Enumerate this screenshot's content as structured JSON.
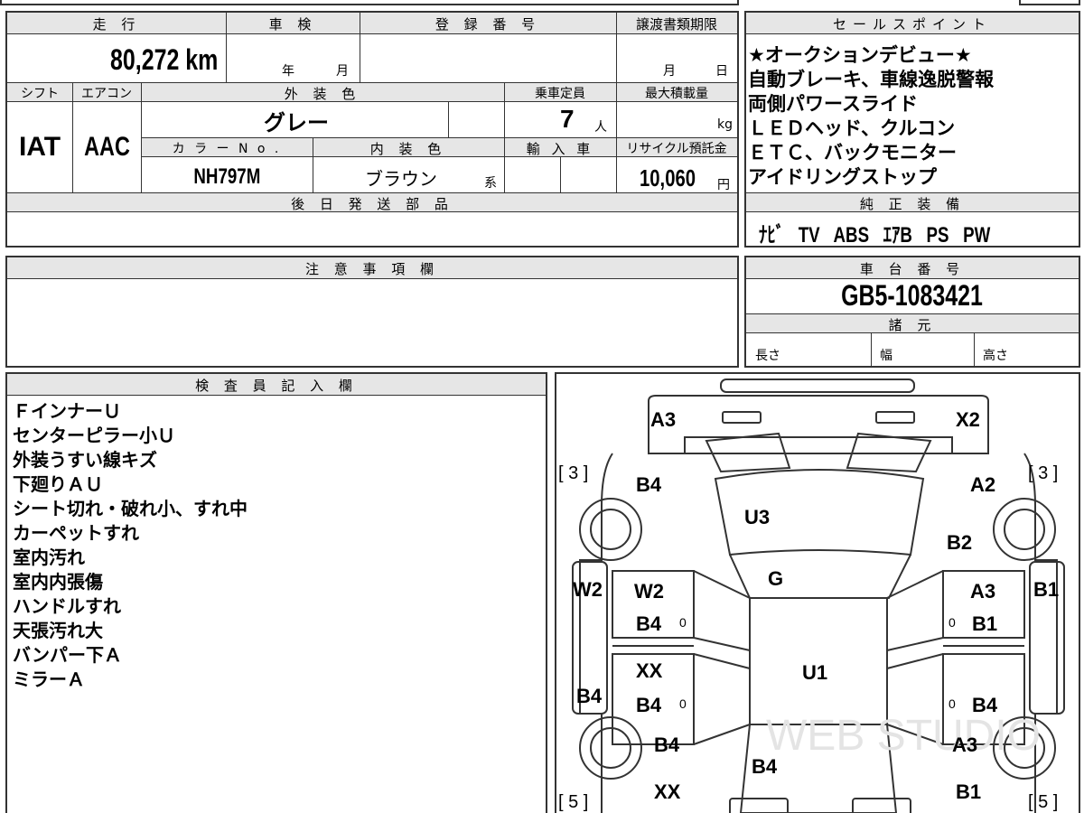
{
  "vehicle": {
    "mileage_label": "走 行",
    "mileage": "80,272 km",
    "shaken_label": "車 検",
    "shaken_year_unit": "年",
    "shaken_month_unit": "月",
    "registration_label": "登 録 番 号",
    "transfer_deadline_label": "譲渡書類期限",
    "transfer_month_unit": "月",
    "transfer_day_unit": "日",
    "shift_label": "シフト",
    "shift": "IAT",
    "aircon_label": "エアコン",
    "aircon": "AAC",
    "exterior_color_label": "外 装 色",
    "exterior_color": "グレー",
    "capacity_label": "乗車定員",
    "capacity": "7",
    "capacity_unit": "人",
    "max_load_label": "最大積載量",
    "max_load_unit": "kg",
    "color_no_label": "カ ラ ー N o .",
    "color_no": "NH797M",
    "interior_color_label": "内 装 色",
    "interior_color": "ブラウン",
    "interior_color_suffix": "系",
    "import_label": "輸 入 車",
    "recycle_label": "リサイクル預託金",
    "recycle_amount": "10,060",
    "recycle_unit": "円",
    "later_parts_label": "後 日 発 送 部 品"
  },
  "sales_points": {
    "label": "セールスポイント",
    "lines": [
      "★オークションデビュー★",
      "自動ブレーキ、車線逸脱警報",
      "両側パワースライド",
      "ＬＥＤヘッド、クルコン",
      "ＥＴＣ、バックモニター",
      "アイドリングストップ"
    ]
  },
  "genuine_equipment": {
    "label": "純 正 装 備",
    "items": [
      "ﾅﾋﾞ",
      "TV",
      "ABS",
      "ｴｱB",
      "PS",
      "PW"
    ]
  },
  "notes": {
    "label": "注 意 事 項 欄"
  },
  "chassis": {
    "label": "車 台 番 号",
    "number": "GB5-1083421",
    "specs_label": "諸 元",
    "length_label": "長さ",
    "width_label": "幅",
    "height_label": "高さ"
  },
  "inspector": {
    "label": "検 査 員 記 入 欄",
    "lines": [
      "ＦインナーＵ",
      "センターピラー小Ｕ",
      "外装うすい線キズ",
      "下廻りＡＵ",
      "シート切れ・破れ小、すれ中",
      "カーペットすれ",
      "室内汚れ",
      "室内内張傷",
      "ハンドルすれ",
      "天張汚れ大",
      "バンパー下Ａ",
      "ミラーＡ"
    ]
  },
  "diagram": {
    "codes": {
      "front_left": "A3",
      "front_right": "X2",
      "bracket_tl": "[ 3 ]",
      "bracket_tr": "[ 3 ]",
      "bracket_bl": "[ 5 ]",
      "bracket_br": "[ 5 ]",
      "left_fender": "B4",
      "right_fender": "A2",
      "windshield": "U3",
      "right_fender_rear": "B2",
      "hood_rear": "G",
      "left_side": "W2",
      "right_side": "B1",
      "left_front_door_1": "W2",
      "left_front_door_2": "B4",
      "right_front_door_1": "A3",
      "right_front_door_2": "B1",
      "roof": "U1",
      "left_rear_door_1": "XX",
      "left_rear_door_2": "B4",
      "right_rear_door": "B4",
      "left_side_lower": "B4",
      "left_quarter": "B4",
      "right_quarter": "A3",
      "rear_glass": "B4",
      "left_rear_bottom": "XX",
      "right_rear_bottom": "B1",
      "zero_1": "0",
      "zero_2": "0",
      "zero_3": "0",
      "zero_4": "0"
    },
    "watermark": "WEB STUDIO"
  }
}
